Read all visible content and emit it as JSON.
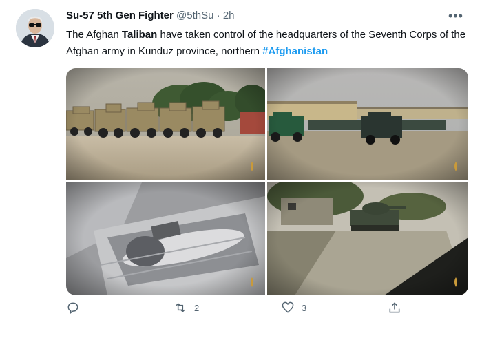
{
  "tweet": {
    "author_name": "Su-57 5th Gen Fighter",
    "handle": "@5thSu",
    "separator": "·",
    "time": "2h",
    "more_label": "•••",
    "text_part1": "The Afghan ",
    "text_bold": "Taliban",
    "text_part2": " have taken control of the headquarters of the Seventh Corps of the Afghan army in Kunduz province, northern ",
    "hashtag": "#Afghanistan"
  },
  "actions": {
    "reply_count": "",
    "retweet_count": "2",
    "like_count": "3"
  },
  "icons": [
    "reply-icon",
    "retweet-icon",
    "like-icon",
    "share-icon",
    "more-icon",
    "watermark-icon"
  ],
  "colors": {
    "link": "#1d9bf0",
    "meta": "#536471",
    "text": "#0f1419"
  }
}
